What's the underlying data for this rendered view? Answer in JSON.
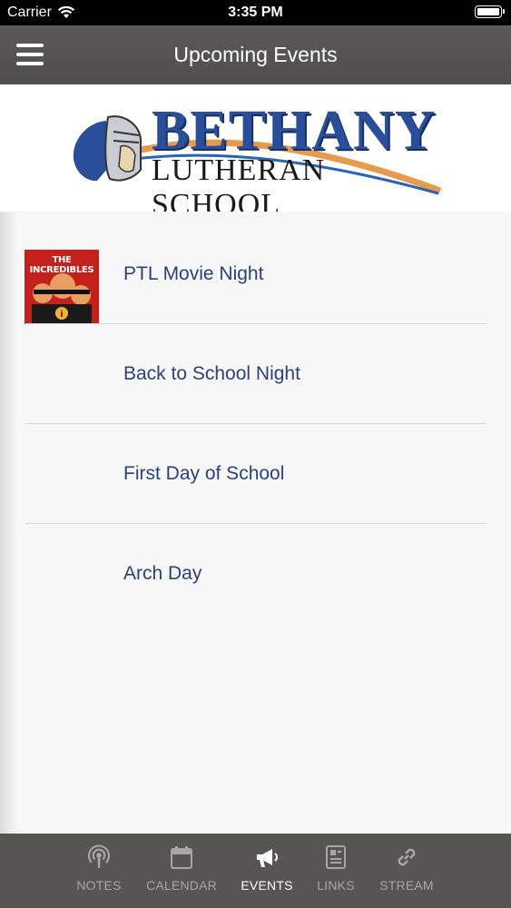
{
  "status_bar": {
    "carrier": "Carrier",
    "time": "3:35 PM"
  },
  "nav": {
    "title": "Upcoming Events"
  },
  "logo": {
    "line1": "BETHANY",
    "line2": "LUTHERAN SCHOOL"
  },
  "events": [
    {
      "name": "PTL Movie Night",
      "thumbnail_title": "THE INCREDIBLES"
    },
    {
      "name": "Back to School Night"
    },
    {
      "name": "First Day of School"
    },
    {
      "name": "Arch Day"
    }
  ],
  "tabs": [
    {
      "label": "NOTES",
      "icon": "podcast-icon"
    },
    {
      "label": "CALENDAR",
      "icon": "calendar-icon"
    },
    {
      "label": "EVENTS",
      "icon": "megaphone-icon",
      "active": true
    },
    {
      "label": "LINKS",
      "icon": "document-icon"
    },
    {
      "label": "STREAM",
      "icon": "link-icon"
    }
  ],
  "colors": {
    "nav_bg": "#55544f",
    "tab_bg": "#565551",
    "event_text": "#2d4078",
    "logo_blue": "#2a4f9a"
  }
}
